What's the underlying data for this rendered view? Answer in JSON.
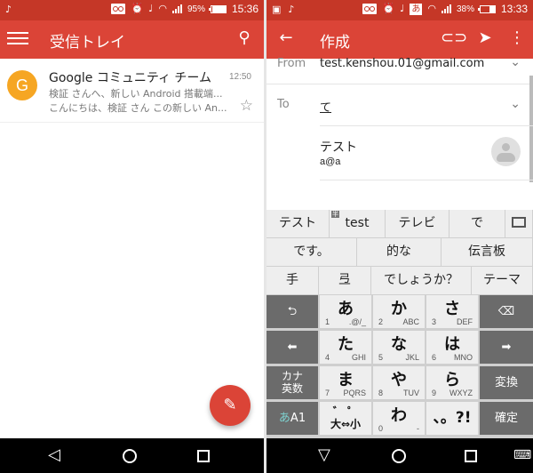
{
  "left_screen": {
    "status_bar": {
      "time": "15:36",
      "battery": "95%",
      "battery_level": 0.95,
      "icons": [
        "notification-icon",
        "voicemail-icon",
        "alarm-icon",
        "music-icon",
        "wifi-icon",
        "signal-icon",
        "battery-charging-icon"
      ]
    },
    "app_bar": {
      "title": "受信トレイ",
      "menu_icon": "hamburger-menu-icon",
      "search_icon": "search-icon"
    },
    "messages": [
      {
        "avatar_letter": "G",
        "avatar_color": "#f6a623",
        "sender": "Google コミュニティ チーム",
        "time": "12:50",
        "subject": "検証 さんへ、新しい Android 搭載端...",
        "snippet": "こんにちは、検証 さん この新しい An...",
        "starred": false
      }
    ],
    "fab_icon": "compose-pencil-icon",
    "nav_bar": [
      "back-icon",
      "home-icon",
      "recents-icon"
    ]
  },
  "right_screen": {
    "status_bar": {
      "time": "13:33",
      "battery": "38%",
      "battery_level": 0.38,
      "ime_badge": "あ",
      "icons": [
        "image-icon",
        "notification-icon",
        "voicemail-icon",
        "alarm-icon",
        "music-icon",
        "ime-icon",
        "wifi-icon",
        "signal-icon",
        "battery-charging-icon"
      ]
    },
    "app_bar": {
      "title": "作成",
      "back_icon": "arrow-back-icon",
      "attach_icon": "attach-icon",
      "send_icon": "send-icon",
      "more_icon": "more-vert-icon"
    },
    "compose": {
      "from_label": "From",
      "from_value": "test.kenshou.01@gmail.com",
      "to_label": "To",
      "to_value": "て"
    },
    "suggestion": {
      "name": "テスト",
      "email": "a@a"
    },
    "keyboard": {
      "candidates_row1": [
        "テスト",
        "test",
        "テレビ",
        "で"
      ],
      "candidate_badge": "半",
      "candidates_row2": [
        "です。",
        "的な",
        "伝言板"
      ],
      "candidates_row3": [
        "手",
        "弖",
        "でしょうか？",
        "テーマ"
      ],
      "keys": {
        "a": {
          "kana": "あ",
          "num": "1",
          "alpha": ".@/_"
        },
        "ka": {
          "kana": "か",
          "num": "2",
          "alpha": "ABC"
        },
        "sa": {
          "kana": "さ",
          "num": "3",
          "alpha": "DEF"
        },
        "ta": {
          "kana": "た",
          "num": "4",
          "alpha": "GHI"
        },
        "na": {
          "kana": "な",
          "num": "5",
          "alpha": "JKL"
        },
        "ha": {
          "kana": "は",
          "num": "6",
          "alpha": "MNO"
        },
        "ma": {
          "kana": "ま",
          "num": "7",
          "alpha": "PQRS"
        },
        "ya": {
          "kana": "や",
          "num": "8",
          "alpha": "TUV"
        },
        "ra": {
          "kana": "ら",
          "num": "9",
          "alpha": "WXYZ"
        },
        "wa": {
          "kana": "わ",
          "num": "0",
          "alpha": "-"
        }
      },
      "kana_eisu_line1": "カナ",
      "kana_eisu_line2": "英数",
      "mode_a": "あ",
      "mode_b": "A1",
      "dakuten": "゛ ゜",
      "size_toggle": "大⇔小",
      "punct": "、。?!",
      "convert": "変換",
      "confirm": "確定",
      "undo_icon": "undo-icon",
      "backspace_icon": "backspace-icon",
      "left_icon": "arrow-left-icon",
      "right_icon": "arrow-right-icon"
    },
    "nav_bar": [
      "back-down-icon",
      "home-icon",
      "recents-icon",
      "keyboard-icon"
    ]
  }
}
